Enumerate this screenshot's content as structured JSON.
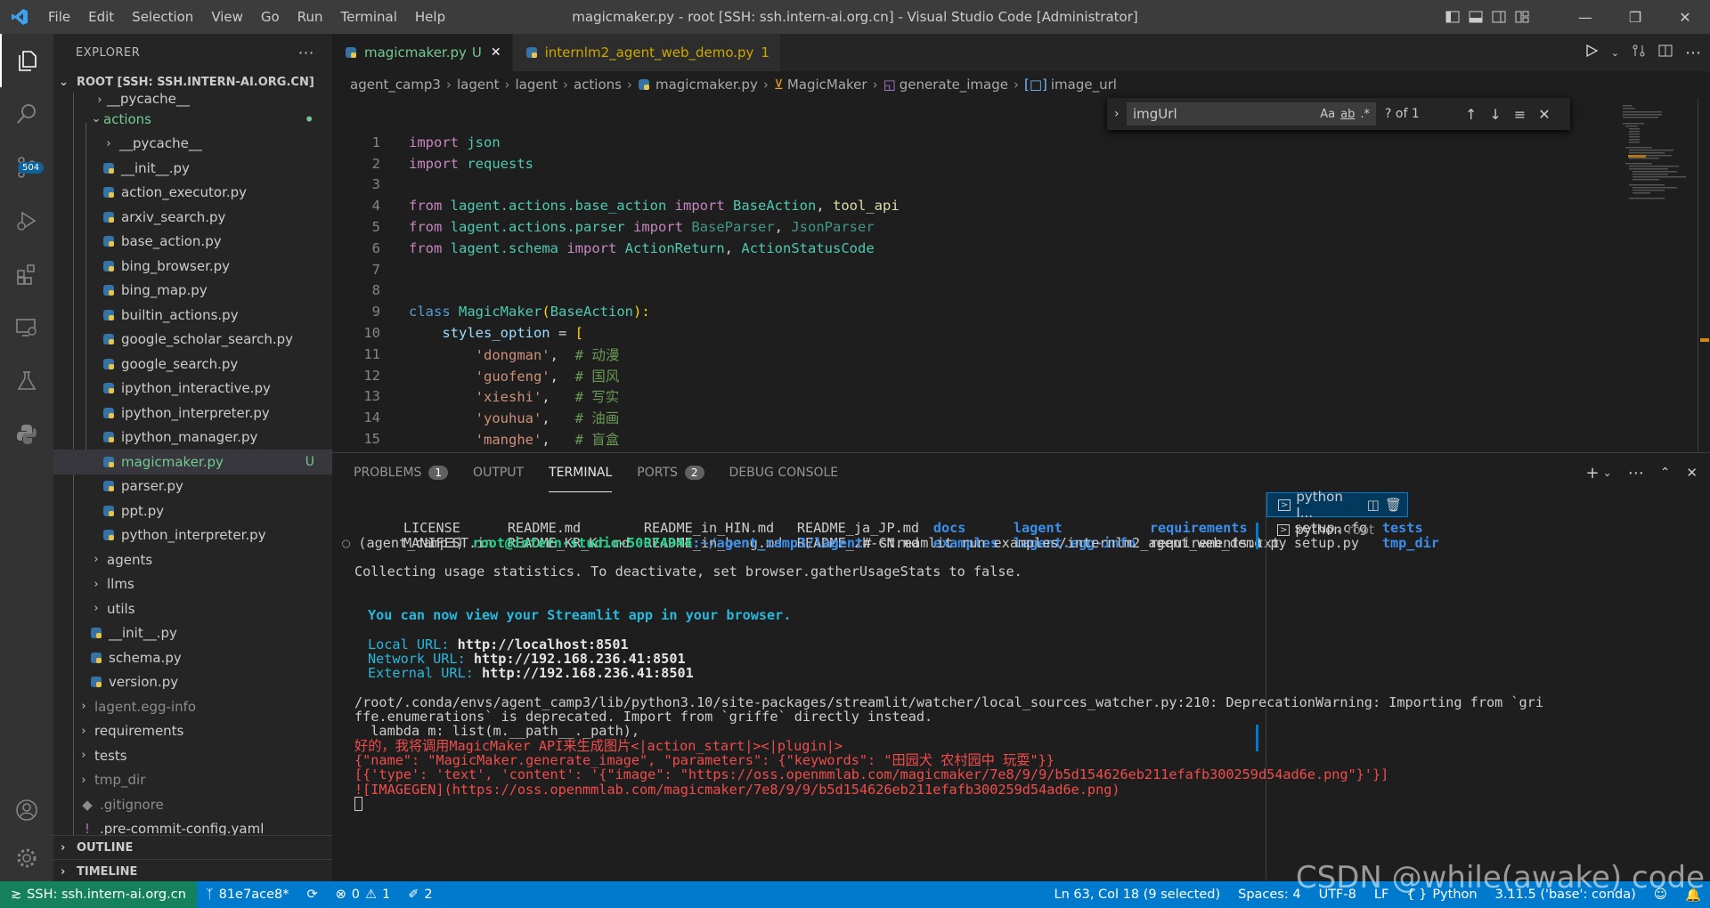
{
  "titlebar": {
    "menu": [
      "File",
      "Edit",
      "Selection",
      "View",
      "Go",
      "Run",
      "Terminal",
      "Help"
    ],
    "title": "magicmaker.py - root [SSH: ssh.intern-ai.org.cn] - Visual Studio Code [Administrator]"
  },
  "activity": {
    "scm_badge": "504"
  },
  "sidebar": {
    "header": "EXPLORER",
    "root": "ROOT [SSH: SSH.INTERN-AI.ORG.CN]",
    "items": [
      {
        "label": "__pycache__",
        "status": ""
      },
      {
        "label": "actions",
        "status": "•"
      },
      {
        "label": "__pycache__",
        "status": ""
      },
      {
        "label": "__init__.py",
        "status": ""
      },
      {
        "label": "action_executor.py",
        "status": ""
      },
      {
        "label": "arxiv_search.py",
        "status": ""
      },
      {
        "label": "base_action.py",
        "status": ""
      },
      {
        "label": "bing_browser.py",
        "status": ""
      },
      {
        "label": "bing_map.py",
        "status": ""
      },
      {
        "label": "builtin_actions.py",
        "status": ""
      },
      {
        "label": "google_scholar_search.py",
        "status": ""
      },
      {
        "label": "google_search.py",
        "status": ""
      },
      {
        "label": "ipython_interactive.py",
        "status": ""
      },
      {
        "label": "ipython_interpreter.py",
        "status": ""
      },
      {
        "label": "ipython_manager.py",
        "status": ""
      },
      {
        "label": "magicmaker.py",
        "status": "U"
      },
      {
        "label": "parser.py",
        "status": ""
      },
      {
        "label": "ppt.py",
        "status": ""
      },
      {
        "label": "python_interpreter.py",
        "status": ""
      },
      {
        "label": "agents",
        "status": ""
      },
      {
        "label": "llms",
        "status": ""
      },
      {
        "label": "utils",
        "status": ""
      },
      {
        "label": "__init__.py",
        "status": ""
      },
      {
        "label": "schema.py",
        "status": ""
      },
      {
        "label": "version.py",
        "status": ""
      },
      {
        "label": "lagent.egg-info",
        "status": ""
      },
      {
        "label": "requirements",
        "status": ""
      },
      {
        "label": "tests",
        "status": ""
      },
      {
        "label": "tmp_dir",
        "status": ""
      },
      {
        "label": ".gitignore",
        "status": ""
      },
      {
        "label": ".pre-commit-config.yaml",
        "status": ""
      }
    ],
    "outline": "OUTLINE",
    "timeline": "TIMELINE"
  },
  "tabs": [
    {
      "label": "magicmaker.py",
      "badge": "U"
    },
    {
      "label": "internlm2_agent_web_demo.py",
      "badge": "1"
    }
  ],
  "breadcrumb": [
    "agent_camp3",
    "lagent",
    "lagent",
    "actions",
    "magicmaker.py",
    "MagicMaker",
    "generate_image",
    "image_url"
  ],
  "find": {
    "query": "imgUrl",
    "count": "? of 1",
    "opts": [
      "Aa",
      "ab",
      ".*"
    ]
  },
  "code": {
    "line_numbers": [
      "1",
      "2",
      "3",
      "4",
      "5",
      "6",
      "7",
      "8",
      "9",
      "10",
      "11",
      "12",
      "13",
      "14",
      "15"
    ],
    "l1": [
      "import",
      "json"
    ],
    "l2": [
      "import",
      "requests"
    ],
    "l4": [
      "from",
      "lagent.actions.base_action",
      "import",
      "BaseAction",
      ",",
      "tool_api"
    ],
    "l5": [
      "from",
      "lagent.actions.parser",
      "import",
      "BaseParser",
      ",",
      "JsonParser"
    ],
    "l6": [
      "from",
      "lagent.schema",
      "import",
      "ActionReturn",
      ",",
      "ActionStatusCode"
    ],
    "l9": [
      "class",
      "MagicMaker",
      "(",
      "BaseAction",
      "):"
    ],
    "l10": [
      "styles_option",
      " = ",
      "["
    ],
    "l11": [
      "'dongman'",
      ",  ",
      "# 动漫"
    ],
    "l12": [
      "'guofeng'",
      ",  ",
      "# 国风"
    ],
    "l13": [
      "'xieshi'",
      ",   ",
      "# 写实"
    ],
    "l14": [
      "'youhua'",
      ",   ",
      "# 油画"
    ],
    "l15": [
      "'manghe'",
      ",   ",
      "# 盲盒"
    ]
  },
  "panel": {
    "tabs": [
      {
        "label": "PROBLEMS",
        "badge": "1"
      },
      {
        "label": "OUTPUT",
        "badge": ""
      },
      {
        "label": "TERMINAL",
        "badge": ""
      },
      {
        "label": "PORTS",
        "badge": "2"
      },
      {
        "label": "DEBUG CONSOLE",
        "badge": ""
      }
    ],
    "terminals": [
      {
        "name": "python I...",
        "sub": ""
      },
      {
        "name": "python",
        "sub": "root"
      }
    ]
  },
  "terminal": {
    "ls1": [
      "LICENSE",
      "README.md",
      "README_in_HIN.md",
      "README_ja_JP.md",
      "docs",
      "lagent",
      "requirements",
      "setup.cfg",
      "tests"
    ],
    "ls2": [
      "MANIFEST.in",
      "README_KR_Kr.md",
      "README_in_beng.md",
      "README_zh-CN.md",
      "examples",
      "lagent.egg-info",
      "requirements.txt",
      "setup.py",
      "tmp_dir"
    ],
    "prompt_env": "(agent_camp3) ",
    "prompt_user": "root@intern-studio-50074944",
    "prompt_path": ":~/agent_camp3/lagent",
    "prompt_cmd": "# streamlit run examples/internlm2_agent_web_demo.py",
    "collecting": "Collecting usage statistics. To deactivate, set browser.gatherUsageStats to false.",
    "view_msg": "You can now view your Streamlit app in your browser.",
    "local_label": "Local URL: ",
    "local_url": "http://localhost:8501",
    "network_label": "Network URL: ",
    "network_url": "http://192.168.236.41:8501",
    "external_label": "External URL: ",
    "external_url": "http://192.168.236.41:8501",
    "warn1": "/root/.conda/envs/agent_camp3/lib/python3.10/site-packages/streamlit/watcher/local_sources_watcher.py:210: DeprecationWarning: Importing from `gri",
    "warn2": "ffe.enumerations` is deprecated. Import from `griffe` directly instead.",
    "warn3": "  lambda m: list(m.__path__._path),",
    "r1": "好的，我将调用MagicMaker API来生成图片<|action_start|><|plugin|>",
    "r2": "{\"name\": \"MagicMaker.generate_image\", \"parameters\": {\"keywords\": \"田园犬 农村园中 玩耍\"}}",
    "r3": "[{'type': 'text', 'content': '{\"image\": \"https://oss.openmmlab.com/magicmaker/7e8/9/9/b5d154626eb211efafb300259d54ad6e.png\"}'}]",
    "r4": "![IMAGEGEN](https://oss.openmmlab.com/magicmaker/7e8/9/9/b5d154626eb211efafb300259d54ad6e.png)"
  },
  "statusbar": {
    "remote": "SSH: ssh.intern-ai.org.cn",
    "branch": "81e7ace8*",
    "errors": "0",
    "warnings": "1",
    "ports": "2",
    "position": "Ln 63, Col 18 (9 selected)",
    "spaces": "Spaces: 4",
    "encoding": "UTF-8",
    "eol": "LF",
    "language": "Python",
    "interpreter": "3.11.5 ('base': conda)"
  },
  "watermark": "CSDN @while(awake) code"
}
